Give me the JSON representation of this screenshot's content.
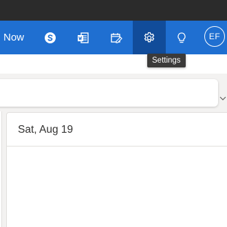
{
  "header": {
    "meet_now_label": "Now",
    "avatar_initials": "EF",
    "accent_color": "#1f6fd1",
    "selected_button_color": "#114c9a",
    "icons": [
      "skype-icon",
      "office-apps-icon",
      "my-day-icon",
      "gear-icon",
      "lightbulb-icon"
    ]
  },
  "tooltip": {
    "text": "Settings"
  },
  "calendar": {
    "day_title": "Sat, Aug 19"
  }
}
